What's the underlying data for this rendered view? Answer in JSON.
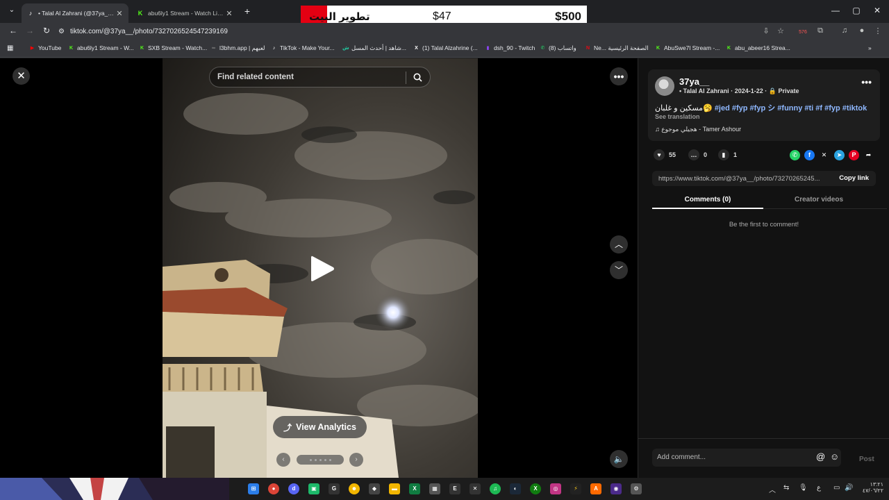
{
  "browser": {
    "tabs": [
      {
        "title": "• Talal Al Zahrani (@37ya__) | TikTok",
        "icon": "tiktok-icon",
        "active": true
      },
      {
        "title": "abu6ly1 Stream - Watch Live on Kick",
        "icon": "kick-icon",
        "active": false
      }
    ],
    "new_tab": "+",
    "tab_search": "⌄",
    "window_controls": {
      "minimize": "—",
      "maximize": "▢",
      "close": "✕"
    },
    "url": "tiktok.com/@37ya__/photo/7327026524547239169",
    "bookmarks": [
      {
        "label": "YouTube",
        "icon": "youtube-icon",
        "color": "#ff0000"
      },
      {
        "label": "abu6ly1 Stream - W...",
        "icon": "kick-icon",
        "color": "#53fc18"
      },
      {
        "label": "SXB Stream - Watch...",
        "icon": "kick-icon",
        "color": "#53fc18"
      },
      {
        "label": "l3bhm.app | لعبهم",
        "icon": "link-icon",
        "color": "#888888"
      },
      {
        "label": "TikTok - Make Your...",
        "icon": "tiktok-icon",
        "color": "#ffffff"
      },
      {
        "label": "شاهد | أحدث المسل...",
        "icon": "shahid-icon",
        "color": "#21d0a6"
      },
      {
        "label": "(1) Talal Alzahrine (...",
        "icon": "x-icon",
        "color": "#ffffff"
      },
      {
        "label": "dsh_90 - Twitch",
        "icon": "twitch-icon",
        "color": "#9146ff"
      },
      {
        "label": "واتساب (8)",
        "icon": "whatsapp-icon",
        "color": "#25d366"
      },
      {
        "label": "Ne... الصفحة الرئيسية",
        "icon": "netflix-icon",
        "color": "#e50914"
      },
      {
        "label": "AbuSwe7l Stream -...",
        "icon": "kick-icon",
        "color": "#53fc18"
      },
      {
        "label": "abu_abeer16 Strea...",
        "icon": "kick-icon",
        "color": "#53fc18"
      }
    ],
    "extension_badge": "576"
  },
  "overlay_ad": {
    "left_text": "تطوير البيت",
    "middle_price": "$47",
    "right_price": "$500"
  },
  "viewer": {
    "search_placeholder": "Find related content",
    "view_analytics": "View Analytics"
  },
  "panel": {
    "username": "37ya__",
    "display_name": "Talal Al Zahrani",
    "date": "2024-1-22",
    "privacy": "Private",
    "caption_text": "مسكين و غلبان🥱",
    "hashtags": "#jed #fyp #fyp シ #funny #ti #f #fyp #tiktok",
    "see_translation": "See translation",
    "music": "هجيلي موجوع - Tamer Ashour",
    "likes": "55",
    "comments": "0",
    "saves": "1",
    "share_link": "https://www.tiktok.com/@37ya__/photo/73270265245...",
    "copy_link": "Copy link",
    "tab_comments": "Comments (0)",
    "tab_creator": "Creator videos",
    "empty_state": "Be the first to comment!",
    "add_comment": "Add comment...",
    "post": "Post"
  },
  "taskbar": {
    "clock_time": "١٣:٢١",
    "clock_date": "٤٧/٠٦/٢٢",
    "lang": "ع"
  }
}
